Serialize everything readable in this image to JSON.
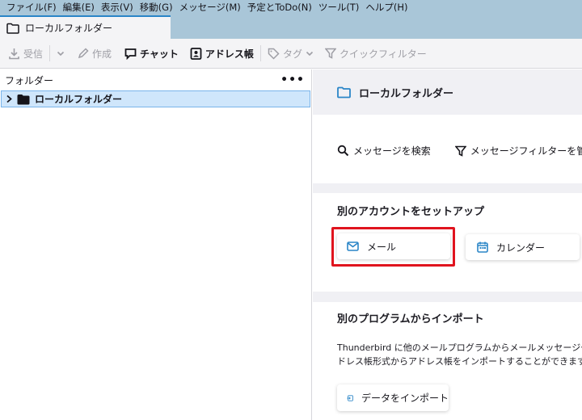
{
  "menu": [
    "ファイル(F)",
    "編集(E)",
    "表示(V)",
    "移動(G)",
    "メッセージ(M)",
    "予定とToDo(N)",
    "ツール(T)",
    "ヘルプ(H)"
  ],
  "tab": {
    "label": "ローカルフォルダー",
    "icon": "folder-icon"
  },
  "toolbar": {
    "receive": "受信",
    "compose": "作成",
    "chat": "チャット",
    "address_book": "アドレス帳",
    "tag": "タグ",
    "quick_filter": "クイックフィルター"
  },
  "folder_pane": {
    "header": "フォルダー",
    "menu_glyph": "•••",
    "folders": [
      {
        "name": "ローカルフォルダー",
        "selected": true
      }
    ]
  },
  "central": {
    "title": "ローカルフォルダー",
    "search_messages": "メッセージを検索",
    "manage_filters": "メッセージフィルターを管理",
    "setup_title": "別のアカウントをセットアップ",
    "mail": "メール",
    "calendar": "カレンダー",
    "import_title": "別のプログラムからインポート",
    "import_desc_line1": "Thunderbird に他のメールプログラムからメールメッセージやフィード購",
    "import_desc_line2": "ドレス帳形式からアドレス帳をインポートすることができます。",
    "import_button": "データをインポート"
  },
  "colors": {
    "accent_blue": "#2a85c7",
    "highlight_red": "#e0141e",
    "menubar_bg": "#a9c6d8"
  }
}
